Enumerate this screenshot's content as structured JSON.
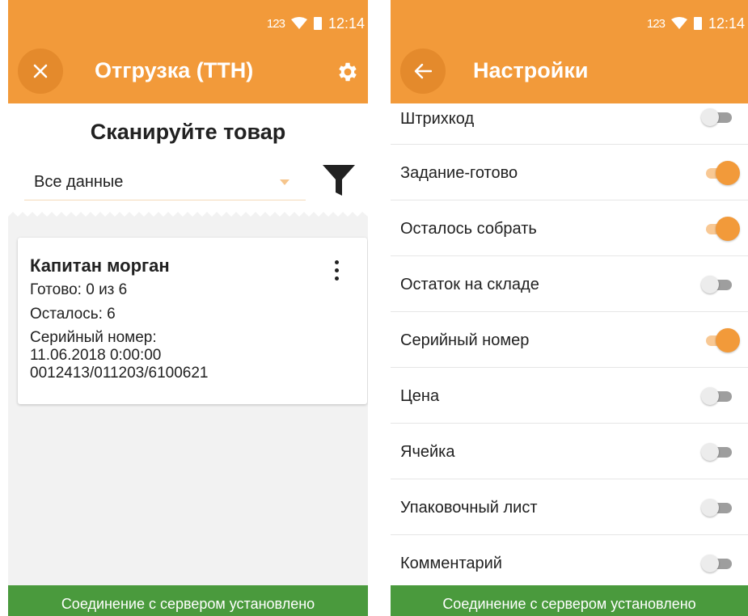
{
  "status": {
    "signal_label": "123",
    "time": "12:14"
  },
  "left": {
    "title": "Отгрузка (ТТН)",
    "heading": "Сканируйте товар",
    "filter_value": "Все данные",
    "card": {
      "title": "Капитан морган",
      "ready": "Готово: 0 из 6",
      "remaining": "Осталось: 6",
      "serial_label": "Серийный номер:",
      "serial_date": "11.06.2018 0:00:00",
      "serial_number": "0012413/011203/6100621"
    },
    "footer": "Соединение с сервером установлено"
  },
  "right": {
    "title": "Настройки",
    "settings": [
      {
        "label": "Штрихкод",
        "enabled": false
      },
      {
        "label": "Задание-готово",
        "enabled": true
      },
      {
        "label": "Осталось собрать",
        "enabled": true
      },
      {
        "label": "Остаток на складе",
        "enabled": false
      },
      {
        "label": "Серийный номер",
        "enabled": true
      },
      {
        "label": "Цена",
        "enabled": false
      },
      {
        "label": "Ячейка",
        "enabled": false
      },
      {
        "label": "Упаковочный лист",
        "enabled": false
      },
      {
        "label": "Комментарий",
        "enabled": false
      }
    ],
    "footer": "Соединение с сервером установлено"
  },
  "colors": {
    "accent": "#f29a3a",
    "footer": "#4a9a3d"
  }
}
